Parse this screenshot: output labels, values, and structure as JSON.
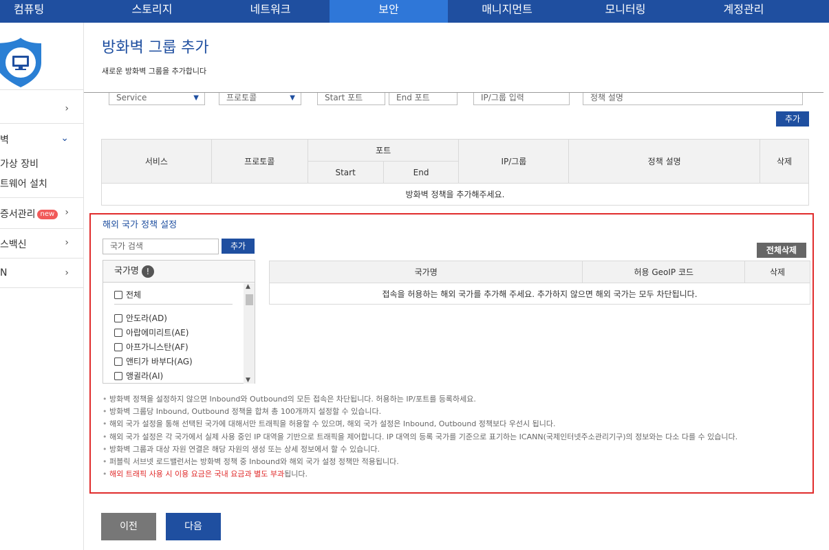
{
  "nav": {
    "items": [
      "컴퓨팅",
      "스토리지",
      "네트워크",
      "보안",
      "매니지먼트",
      "모니터링",
      "계정관리"
    ],
    "active_index": 3
  },
  "sidebar": {
    "items": [
      {
        "label": "",
        "chevron": "›"
      },
      {
        "label": "벽",
        "chevron": "⌄"
      },
      {
        "label": "가상 장비"
      },
      {
        "label": "트웨어 설치"
      },
      {
        "label": "증서관리",
        "badge": "new",
        "chevron": "›"
      },
      {
        "label": "스백신",
        "chevron": "›"
      },
      {
        "label": "N",
        "chevron": "›"
      }
    ]
  },
  "page": {
    "title": "방화벽 그룹 추가",
    "subtitle": "새로운 방화벽 그룹을 추가합니다"
  },
  "policy_form": {
    "service_value": "Service",
    "protocol_value": "프로토콜",
    "start_port_placeholder": "Start 포트",
    "end_port_placeholder": "End 포트",
    "ip_group_placeholder": "IP/그룹 입력",
    "description_placeholder": "정책 설명",
    "add_button": "추가"
  },
  "policy_table": {
    "headers": {
      "service": "서비스",
      "protocol": "프로토콜",
      "port": "포트",
      "start": "Start",
      "end": "End",
      "ip_group": "IP/그룹",
      "description": "정책 설명",
      "delete": "삭제"
    },
    "empty_message": "방화벽 정책을 추가해주세요."
  },
  "overseas": {
    "title": "해외 국가 정책 설정",
    "search_placeholder": "국가 검색",
    "add_button": "추가",
    "delete_all_button": "전체삭제",
    "country_list_header": "국가명",
    "countries": [
      "전체",
      "안도라(AD)",
      "아랍에미리트(AE)",
      "아프가니스탄(AF)",
      "앤티가 바부다(AG)",
      "앵귈라(AI)"
    ],
    "table_headers": {
      "country": "국가명",
      "geoip": "허용 GeoIP 코드",
      "delete": "삭제"
    },
    "empty_message": "접속을 허용하는 해외 국가를 추가해 주세요. 추가하지 않으면 해외 국가는 모두 차단됩니다.",
    "notes": [
      "방화벽 정책을 설정하지 않으면 Inbound와 Outbound의 모든 접속은 차단됩니다. 허용하는 IP/포트를 등록하세요.",
      "방화벽 그룹당 Inbound, Outbound 정책을 합쳐 총 100개까지 설정할 수 있습니다.",
      "해외 국가 설정을 통해 선택된 국가에 대해서만 트래픽을 허용할 수 있으며, 해외 국가 설정은 Inbound, Outbound 정책보다 우선시 됩니다.",
      "해외 국가 설정은 각 국가에서 실제 사용 중인 IP 대역을 기반으로 트래픽을 제어합니다. IP 대역의 등록 국가를 기준으로 표기하는 ICANN(국제인터넷주소관리기구)의 정보와는 다소 다를 수 있습니다.",
      "방화벽 그룹과 대상 자원 연결은 해당 자원의 생성 또는 상세 정보에서 할 수 있습니다.",
      "퍼블릭 서브넷 로드밸런서는 방화벽 정책 중 Inbound와 해외 국가 설정 정책만 적용됩니다."
    ],
    "warning_red": "해외 트래픽 사용 시 이용 요금은 국내 요금과 별도 부과",
    "warning_rest": "됩니다."
  },
  "footer": {
    "prev_button": "이전",
    "next_button": "다음"
  },
  "colors": {
    "nav_bg": "#1f4fa0",
    "nav_active": "#2f77d8",
    "accent_blue": "#1f4fa0",
    "alert_red": "#e02b2b"
  }
}
